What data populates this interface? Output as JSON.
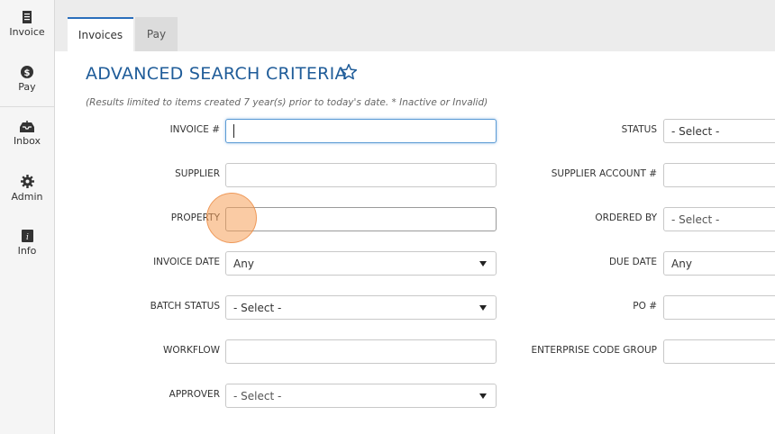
{
  "sidebar": {
    "items": [
      {
        "label": "Invoice",
        "icon": "invoice-icon"
      },
      {
        "label": "Pay",
        "icon": "dollar-icon"
      },
      {
        "label": "Inbox",
        "icon": "inbox-icon"
      },
      {
        "label": "Admin",
        "icon": "gear-icon"
      },
      {
        "label": "Info",
        "icon": "info-icon"
      }
    ]
  },
  "tabs": [
    {
      "label": "Invoices",
      "active": true
    },
    {
      "label": "Pay",
      "active": false
    }
  ],
  "page": {
    "title": "ADVANCED SEARCH CRITERIA",
    "note": "(Results limited to items created 7 year(s) prior to today's date. * Inactive or Invalid)"
  },
  "form": {
    "left": [
      {
        "label": "INVOICE #",
        "type": "text",
        "value": ""
      },
      {
        "label": "SUPPLIER",
        "type": "text",
        "value": ""
      },
      {
        "label": "PROPERTY",
        "type": "text",
        "value": ""
      },
      {
        "label": "INVOICE DATE",
        "type": "select",
        "value": "Any"
      },
      {
        "label": "BATCH STATUS",
        "type": "select",
        "value": "- Select -"
      },
      {
        "label": "WORKFLOW",
        "type": "text",
        "value": ""
      },
      {
        "label": "APPROVER",
        "type": "select",
        "value": "- Select -"
      }
    ],
    "right": [
      {
        "label": "STATUS",
        "type": "select",
        "value": "- Select -"
      },
      {
        "label": "SUPPLIER ACCOUNT #",
        "type": "text",
        "value": ""
      },
      {
        "label": "ORDERED BY",
        "type": "select",
        "value": "- Select -"
      },
      {
        "label": "DUE DATE",
        "type": "select",
        "value": "Any"
      },
      {
        "label": "PO #",
        "type": "text",
        "value": ""
      },
      {
        "label": "ENTERPRISE CODE GROUP",
        "type": "text",
        "value": ""
      }
    ]
  },
  "colors": {
    "accent": "#1f5c99",
    "tab_border": "#2a6ebb",
    "focus": "#5b9bd5",
    "click_marker": "#f5a05a"
  }
}
